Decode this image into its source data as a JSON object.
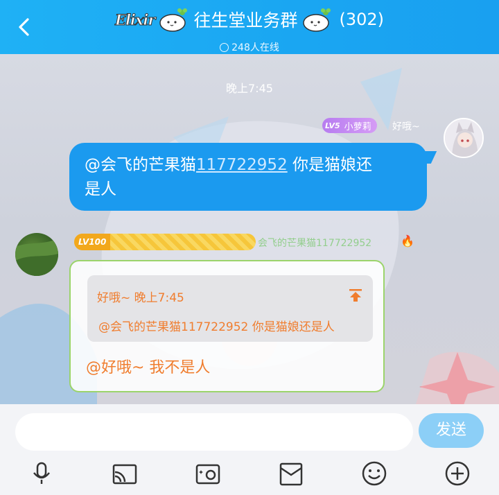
{
  "header": {
    "back_label": "<",
    "brand": "Elixir",
    "title": "往生堂业务群",
    "member_count": "(302)",
    "online": "248人在线"
  },
  "chat": {
    "time_separator": "晚上7:45",
    "messages": [
      {
        "side": "right",
        "level": "LV5",
        "title_badge": "小萝莉",
        "sender": "好哦~",
        "text_prefix": "@会飞的芒果猫",
        "mention_id": "117722952",
        "text_suffix": " 你是猫娘还",
        "text_line2": "是人"
      },
      {
        "side": "left",
        "level": "LV100",
        "sender": "会飞的芒果猫117722952",
        "quote": {
          "header": "好哦~ 晚上7:45",
          "body": "@会飞的芒果猫117722952 你是猫娘还是人"
        },
        "reply": "@好哦~ 我不是人"
      }
    ]
  },
  "input": {
    "value": "",
    "send_label": "发送"
  },
  "toolbar": {
    "icons": [
      "microphone-icon",
      "cast-icon",
      "photo-icon",
      "envelope-icon",
      "emoji-icon",
      "plus-icon"
    ]
  },
  "colors": {
    "header": "#1aa6f2",
    "bubble_self": "#1b9aef",
    "reply_text": "#f07d2e",
    "send_button": "#8ccff7"
  }
}
